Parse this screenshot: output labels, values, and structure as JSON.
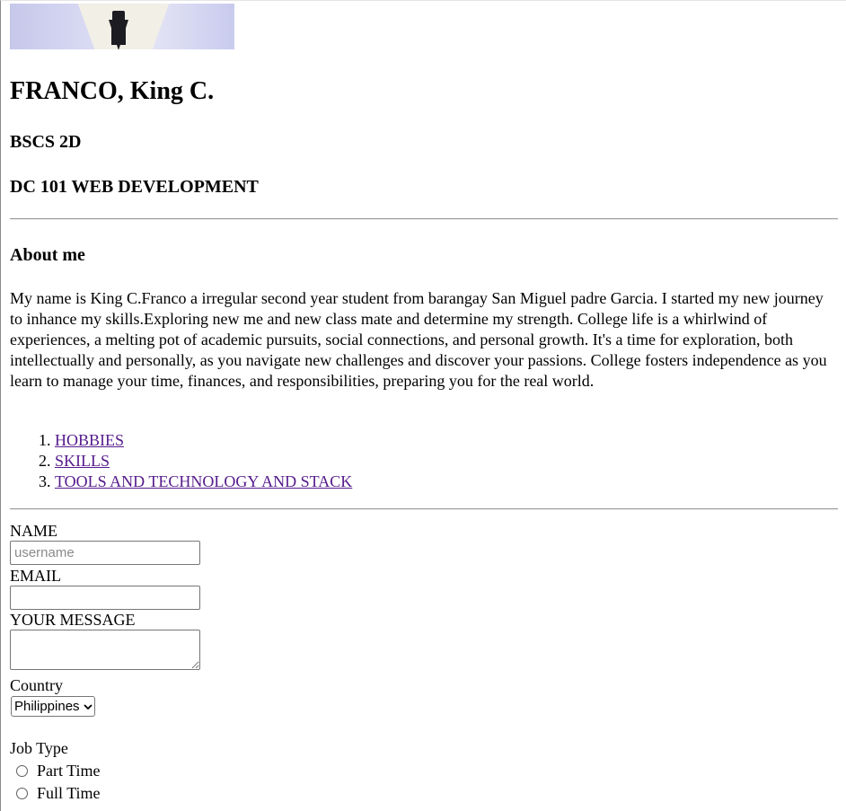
{
  "profile": {
    "photo_alt": "profile photo",
    "name": "FRANCO, King C.",
    "course": "BSCS 2D",
    "subject": "DC 101 WEB DEVELOPMENT"
  },
  "about": {
    "heading": "About me",
    "text": "My name is King C.Franco a irregular second year student from barangay San Miguel padre Garcia. I started my new journey to inhance my skills.Exploring new me and new class mate and determine my strength. College life is a whirlwind of experiences, a melting pot of academic pursuits, social connections, and personal growth. It's a time for exploration, both intellectually and personally, as you navigate new challenges and discover your passions. College fosters independence as you learn to manage your time, finances, and responsibilities, preparing you for the real world."
  },
  "links": [
    {
      "label": "HOBBIES"
    },
    {
      "label": "SKILLS"
    },
    {
      "label": "TOOLS AND TECHNOLOGY AND STACK"
    }
  ],
  "form": {
    "name_label": "NAME",
    "name_placeholder": "username",
    "name_value": "",
    "email_label": "EMAIL",
    "email_value": "",
    "message_label": "YOUR MESSAGE",
    "message_value": "",
    "country_label": "Country",
    "country_selected": "Philippines",
    "job_label": "Job Type",
    "job_options": [
      "Part Time",
      "Full Time"
    ]
  },
  "colors": {
    "visited_link": "#551a8b",
    "rule": "#9a9a9a"
  }
}
